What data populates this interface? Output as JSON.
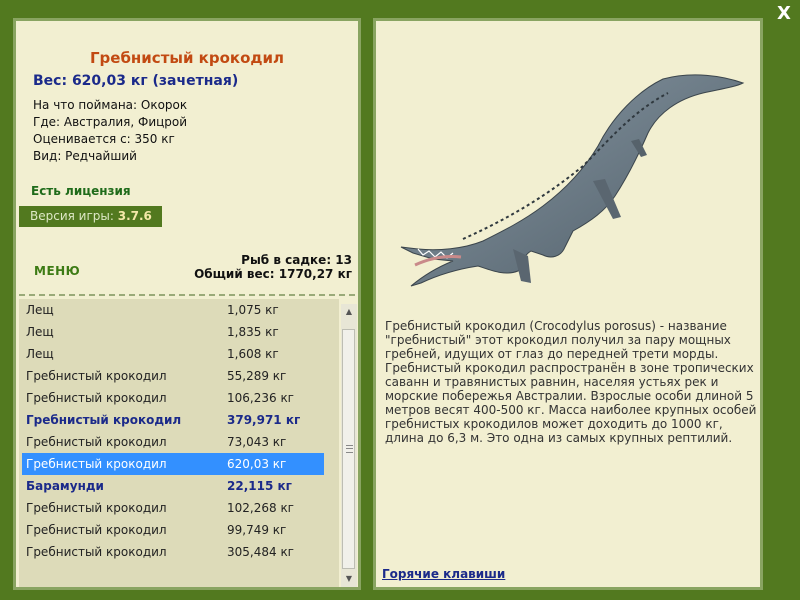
{
  "close_label": "X",
  "fish": {
    "title": "Гребнистый крокодил",
    "weight_line": "Вес: 620,03 кг (зачетная)",
    "caught_on": "На что поймана: Окорок",
    "location": "Где: Австралия, Фицрой",
    "valued_from": "Оценивается с: 350 кг",
    "rarity": "Вид: Редчайший"
  },
  "license_text": "Есть лицензия",
  "version": {
    "label": "Версия игры: ",
    "value": "3.7.6"
  },
  "menu_label": "МЕНЮ",
  "cage": {
    "fish_count": "Рыб в садке: 13",
    "total_weight": "Общий вес: 1770,27 кг"
  },
  "catch_list": [
    {
      "name": "Лещ",
      "weight": "1,075 кг",
      "style": "normal"
    },
    {
      "name": "Лещ",
      "weight": "1,835 кг",
      "style": "normal"
    },
    {
      "name": "Лещ",
      "weight": "1,608 кг",
      "style": "normal"
    },
    {
      "name": "Гребнистый крокодил",
      "weight": "55,289 кг",
      "style": "normal"
    },
    {
      "name": "Гребнистый крокодил",
      "weight": "106,236 кг",
      "style": "normal"
    },
    {
      "name": "Гребнистый крокодил",
      "weight": "379,971 кг",
      "style": "bold"
    },
    {
      "name": "Гребнистый крокодил",
      "weight": "73,043 кг",
      "style": "normal"
    },
    {
      "name": "Гребнистый крокодил",
      "weight": "620,03 кг",
      "style": "selected"
    },
    {
      "name": "Барамунди",
      "weight": "22,115 кг",
      "style": "bold"
    },
    {
      "name": "Гребнистый крокодил",
      "weight": "102,268 кг",
      "style": "normal"
    },
    {
      "name": "Гребнистый крокодил",
      "weight": "99,749 кг",
      "style": "normal"
    },
    {
      "name": "Гребнистый крокодил",
      "weight": "305,484 кг",
      "style": "normal"
    }
  ],
  "description": "Гребнистый крокодил (Crocodylus porosus) - название \"гребнистый\" этот крокодил получил за пару мощных гребней, идущих от глаз до передней трети морды. Гребнистый крокодил распространён в зоне тропических саванн и травянистых равнин, населяя устьях рек и морские побережья Австралии. Взрослые особи длиной 5 метров весят 400-500 кг. Масса наиболее крупных особей гребнистых крокодилов может доходить до 1000 кг, длина до 6,3 м. Это одна из самых крупных рептилий.",
  "hotkeys_label": "Горячие клавиши",
  "colors": {
    "background": "#52791f",
    "panel": "#f2efd1",
    "title": "#c24a12",
    "accent_blue": "#1b2a8a",
    "selection": "#3390ff"
  }
}
